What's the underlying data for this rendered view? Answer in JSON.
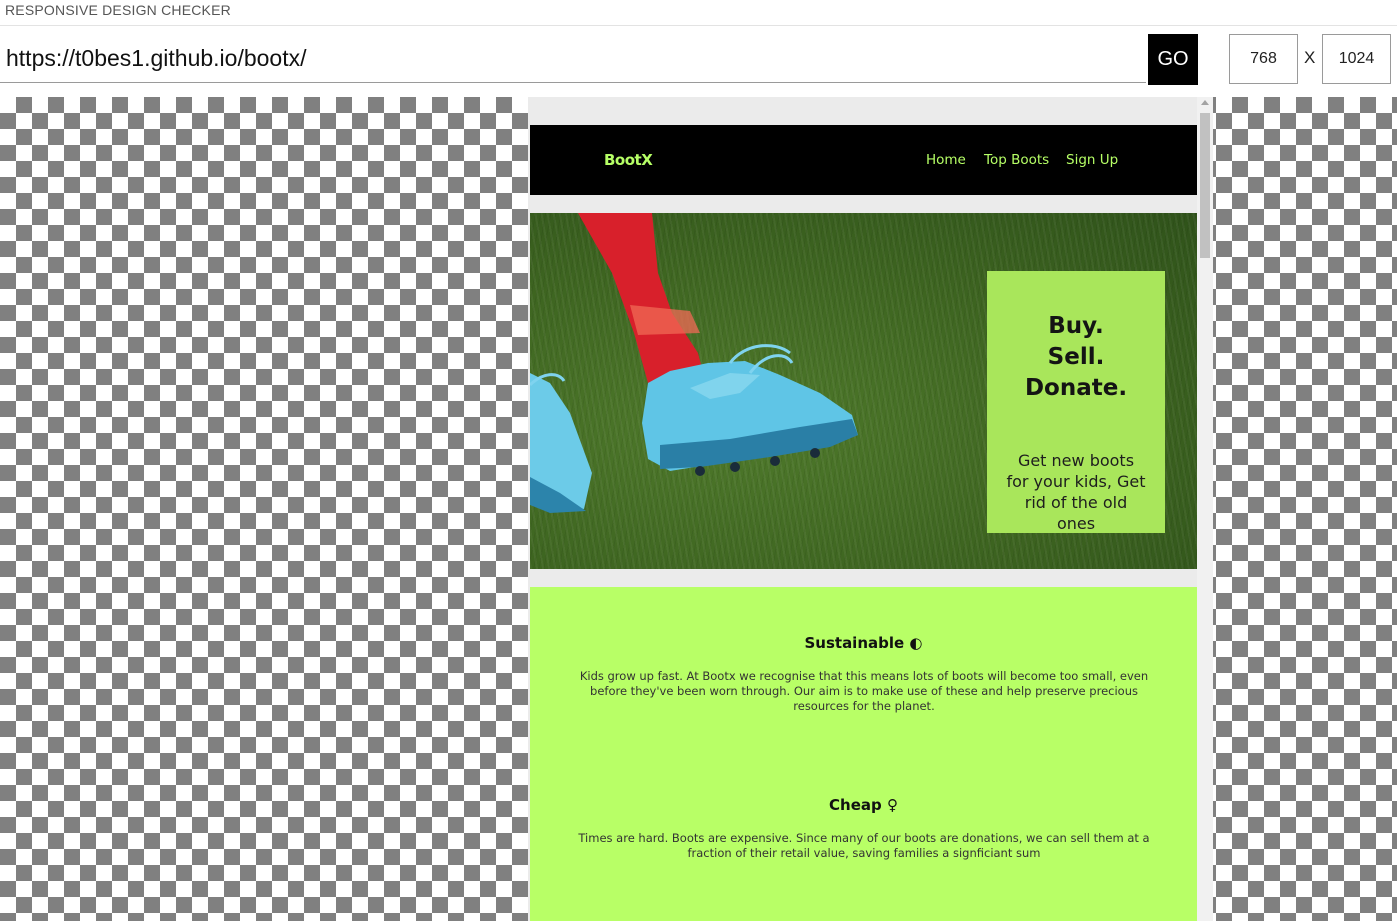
{
  "tool": {
    "title": "RESPONSIVE DESIGN CHECKER",
    "url": "https://t0bes1.github.io/bootx/",
    "go_label": "GO",
    "width": "768",
    "height": "1024",
    "separator": "X"
  },
  "site": {
    "logo": "BootX",
    "nav": [
      "Home",
      "Top Boots",
      "Sign Up"
    ],
    "hero": {
      "lines": [
        "Buy.",
        "Sell.",
        "Donate."
      ],
      "subtitle": "Get new boots for your kids, Get rid of the old ones"
    },
    "features": [
      {
        "title": "Sustainable",
        "icon": "globe-icon",
        "glyph": "◐",
        "text": "Kids grow up fast. At Bootx we recognise that this means lots of boots will become too small, even before they've been worn through. Our aim is to make use of these and help preserve precious resources for the planet."
      },
      {
        "title": "Cheap",
        "icon": "money-bag-icon",
        "glyph": "♀",
        "text": "Times are hard. Boots are expensive. Since many of our boots are donations, we can sell them at a fraction of their retail value, saving families a signficiant sum"
      }
    ]
  },
  "colors": {
    "accent": "#b8ff66",
    "cta_bg": "#a9e65b",
    "nav_bg": "#000000"
  }
}
